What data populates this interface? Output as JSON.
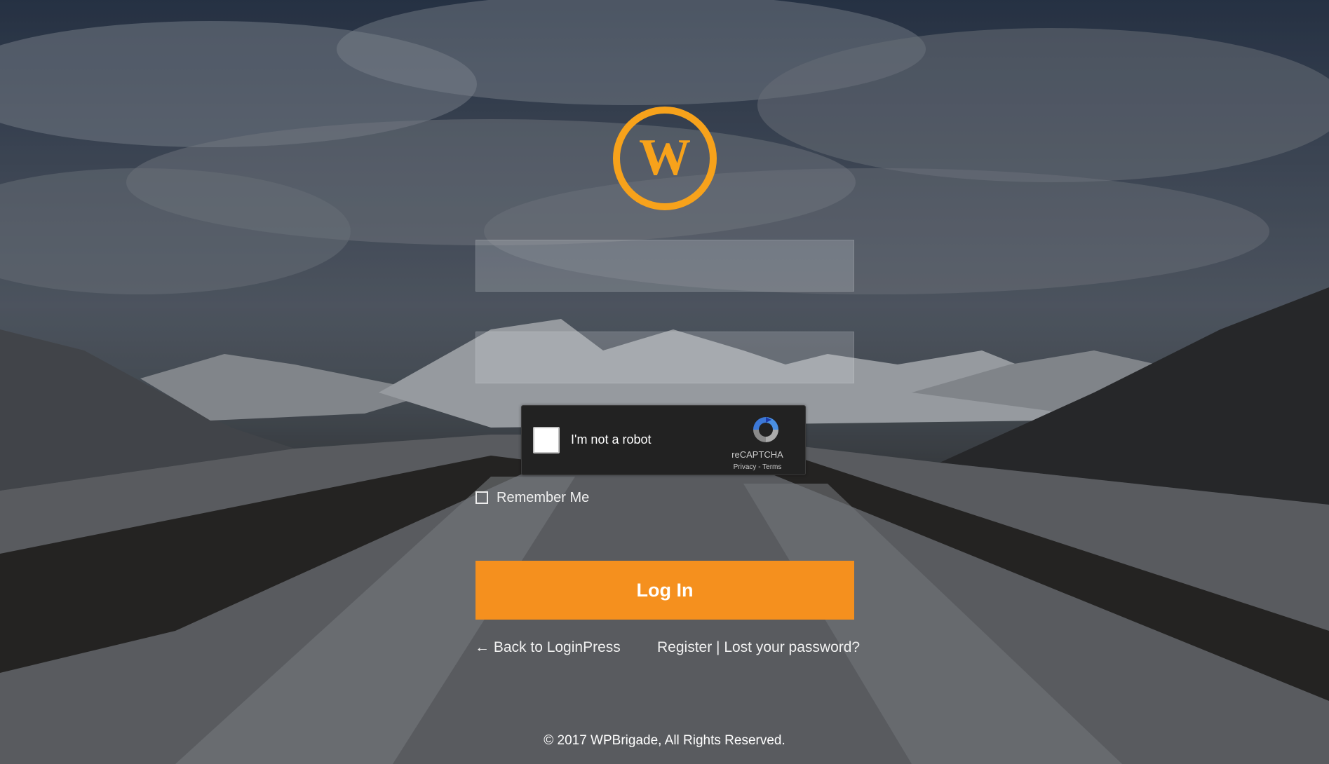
{
  "login_form": {
    "username_value": "",
    "password_value": "",
    "remember_label": "Remember Me",
    "submit_label": "Log In"
  },
  "recaptcha": {
    "label": "I'm not a robot",
    "brand": "reCAPTCHA",
    "privacy_link": "Privacy",
    "separator": " - ",
    "terms_link": "Terms"
  },
  "nav": {
    "back_link": "← Back to LoginPress",
    "register_link": "Register",
    "separator": " | ",
    "lost_password_link": "Lost your password?"
  },
  "footer": {
    "copyright": "© 2017 WPBrigade, All Rights Reserved."
  },
  "colors": {
    "accent": "#f5901e",
    "logo": "#f7a21b",
    "recaptcha_bg": "#222222"
  },
  "icons": {
    "logo": "wordpress-logo-icon",
    "recaptcha": "recaptcha-logo-icon"
  }
}
